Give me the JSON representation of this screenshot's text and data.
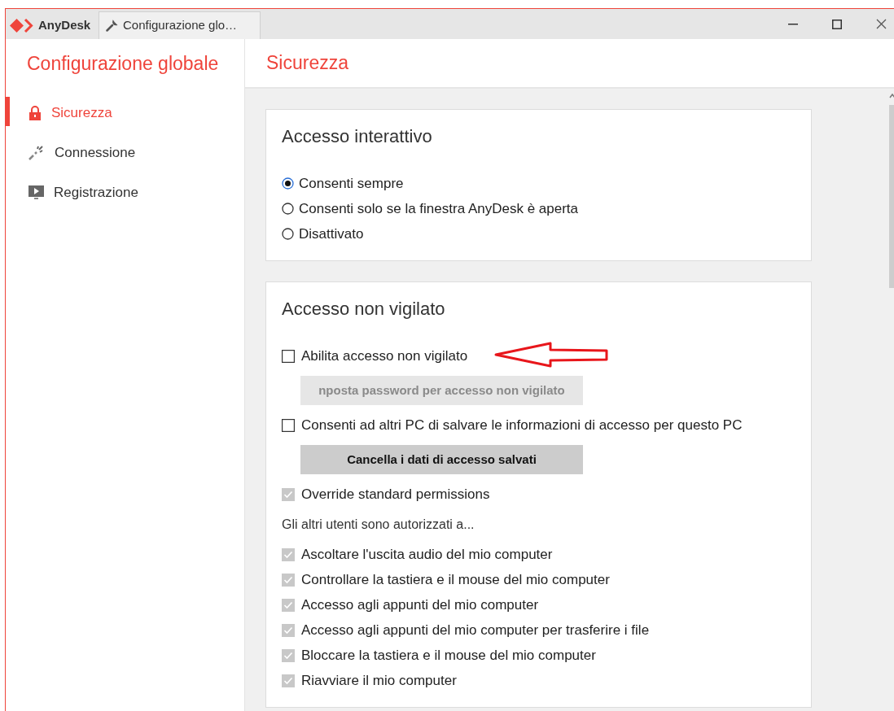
{
  "window": {
    "tabs": [
      {
        "label": "AnyDesk",
        "kind": "app",
        "selected": false
      },
      {
        "label": "Configurazione glo…",
        "kind": "settings",
        "selected": true
      }
    ]
  },
  "sidebar": {
    "title": "Configurazione globale",
    "items": [
      {
        "label": "Sicurezza",
        "kind": "lock",
        "selected": true
      },
      {
        "label": "Connessione",
        "kind": "plug",
        "selected": false
      },
      {
        "label": "Registrazione",
        "kind": "play",
        "selected": false
      }
    ]
  },
  "page": {
    "title": "Sicurezza"
  },
  "sections": [
    {
      "title": "Accesso interattivo",
      "items": [
        {
          "kind": "radio",
          "label": "Consenti sempre",
          "selected": true
        },
        {
          "kind": "radio",
          "label": "Consenti solo se la finestra AnyDesk è aperta",
          "selected": false
        },
        {
          "kind": "radio",
          "label": "Disattivato",
          "selected": false
        }
      ]
    },
    {
      "title": "Accesso non vigilato",
      "items": [
        {
          "kind": "checkbox",
          "label": "Abilita accesso non vigilato",
          "checked": false,
          "disabled": false
        },
        {
          "kind": "button",
          "label": "nposta password per accesso non vigilato",
          "disabled": true
        },
        {
          "kind": "checkbox",
          "label": "Consenti ad altri PC di salvare le informazioni di accesso per questo PC",
          "checked": false,
          "disabled": false
        },
        {
          "kind": "button",
          "label": "Cancella i dati di accesso salvati",
          "disabled": false
        },
        {
          "kind": "checkbox",
          "label": "Override standard permissions",
          "checked": true,
          "disabled": true
        },
        {
          "kind": "text",
          "label": "Gli altri utenti sono autorizzati a..."
        },
        {
          "kind": "checkbox",
          "label": "Ascoltare l'uscita audio del mio computer",
          "checked": true,
          "disabled": true
        },
        {
          "kind": "checkbox",
          "label": "Controllare la tastiera e il mouse del mio computer",
          "checked": true,
          "disabled": true
        },
        {
          "kind": "checkbox",
          "label": "Accesso agli appunti del mio computer",
          "checked": true,
          "disabled": true
        },
        {
          "kind": "checkbox",
          "label": "Accesso agli appunti del mio computer per trasferire i file",
          "checked": true,
          "disabled": true
        },
        {
          "kind": "checkbox",
          "label": "Bloccare la tastiera e il mouse del mio computer",
          "checked": true,
          "disabled": true
        },
        {
          "kind": "checkbox",
          "label": "Riavviare il mio computer",
          "checked": true,
          "disabled": true
        }
      ]
    }
  ]
}
